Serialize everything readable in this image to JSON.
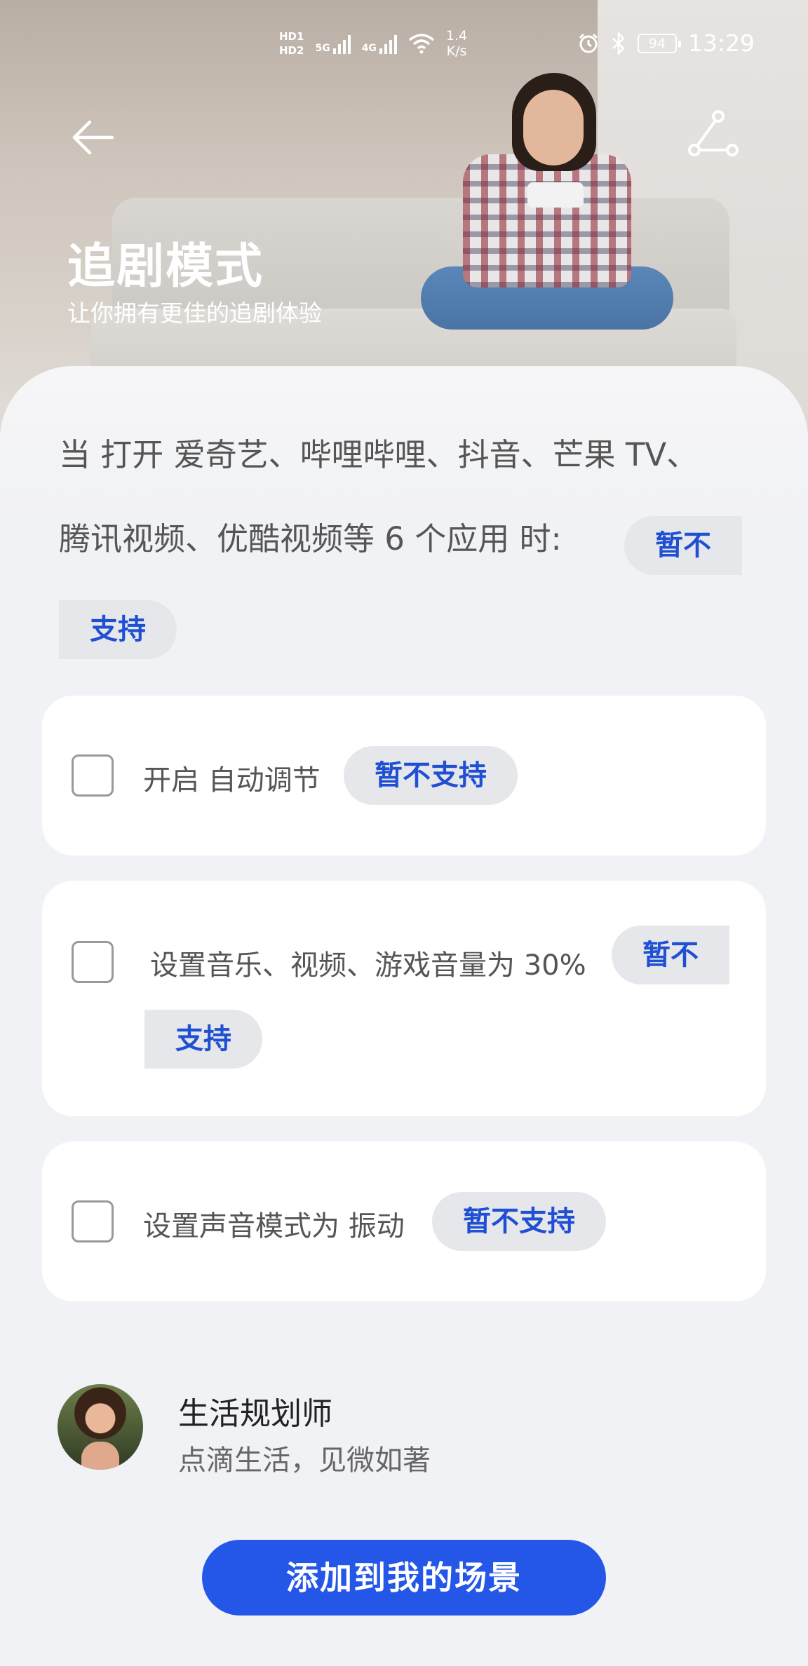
{
  "status_bar": {
    "hd1": "HD1",
    "hd2": "HD2",
    "net1": "5G",
    "net2": "4G",
    "speed_value": "1.4",
    "speed_unit": "K/s",
    "battery": "94",
    "time": "13:29"
  },
  "header": {
    "title": "追剧模式",
    "subtitle": "让你拥有更佳的追剧体验"
  },
  "condition": {
    "line1": "当 打开 爱奇艺、哔哩哔哩、抖音、芒果 TV、",
    "line2": "腾讯视频、优酷视频等 6 个应用 时:",
    "status_part1": "暂不",
    "status_part2": "支持"
  },
  "actions": [
    {
      "label": "开启 自动调节",
      "status": "暂不支持",
      "checked": false
    },
    {
      "label": "设置音乐、视频、游戏音量为 30%",
      "status_part1": "暂不",
      "status_part2": "支持",
      "checked": false
    },
    {
      "label": "设置声音模式为 振动",
      "status": "暂不支持",
      "checked": false
    }
  ],
  "author": {
    "name": "生活规划师",
    "description": "点滴生活，见微如著"
  },
  "add_button": "添加到我的场景",
  "colors": {
    "accent": "#2457e8",
    "pill_text": "#1f4fd3",
    "pill_bg": "#e6e7ea"
  }
}
